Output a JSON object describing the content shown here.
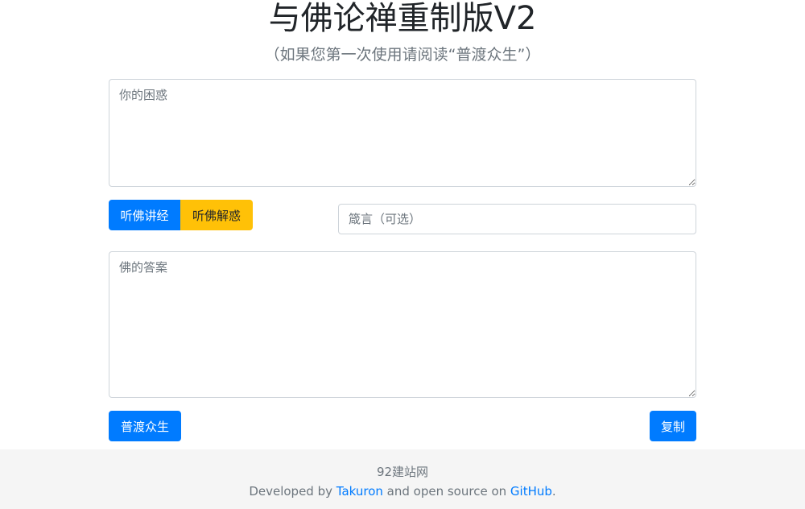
{
  "header": {
    "title": "与佛论禅重制版V2",
    "subtitle": "（如果您第一次使用请阅读“普渡众生”）"
  },
  "question": {
    "placeholder": "你的困惑",
    "value": ""
  },
  "actions": {
    "encode_label": "听佛讲经",
    "decode_label": "听佛解惑"
  },
  "key": {
    "placeholder": "箴言（可选）",
    "value": ""
  },
  "answer": {
    "placeholder": "佛的答案",
    "value": ""
  },
  "bottom": {
    "help_label": "普渡众生",
    "copy_label": "复制"
  },
  "footer": {
    "site": "92建站网",
    "developed_by": "Developed by",
    "author": "Takuron",
    "middle": "and open source on",
    "repo": "GitHub",
    "end": "."
  },
  "colors": {
    "primary": "#007bff",
    "warning": "#ffc107",
    "footer_bg": "#f5f5f5"
  }
}
